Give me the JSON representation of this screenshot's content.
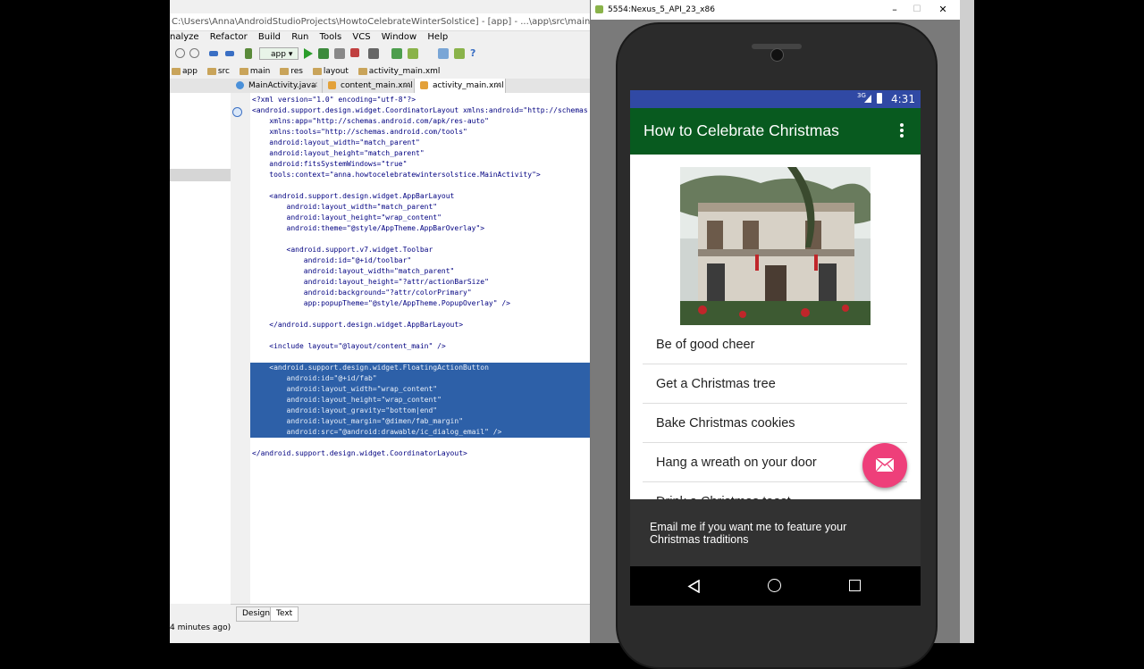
{
  "ide": {
    "title": "C:\\Users\\Anna\\AndroidStudioProjects\\HowtoCelebrateWinterSolstice] - [app] - ...\\app\\src\\main\\res\\layout\\activity_main.xml",
    "menu": [
      "nalyze",
      "Refactor",
      "Build",
      "Run",
      "Tools",
      "VCS",
      "Window",
      "Help"
    ],
    "toolbar_combo": "app",
    "breadcrumb": [
      "app",
      "src",
      "main",
      "res",
      "layout",
      "activity_main.xml"
    ],
    "tabs": [
      {
        "label": "MainActivity.java",
        "color": "#4a90d9"
      },
      {
        "label": "content_main.xml",
        "color": "#e3a13a"
      },
      {
        "label": "activity_main.xml",
        "color": "#e3a13a"
      }
    ],
    "bottom_tabs": [
      "Design",
      "Text"
    ],
    "status": "4 minutes ago)",
    "code_lines": [
      "<?xml version=\"1.0\" encoding=\"utf-8\"?>",
      "<android.support.design.widget.CoordinatorLayout xmlns:android=\"http://schemas",
      "    xmlns:app=\"http://schemas.android.com/apk/res-auto\"",
      "    xmlns:tools=\"http://schemas.android.com/tools\"",
      "    android:layout_width=\"match_parent\"",
      "    android:layout_height=\"match_parent\"",
      "    android:fitsSystemWindows=\"true\"",
      "    tools:context=\"anna.howtocelebratewintersolstice.MainActivity\">",
      "",
      "    <android.support.design.widget.AppBarLayout",
      "        android:layout_width=\"match_parent\"",
      "        android:layout_height=\"wrap_content\"",
      "        android:theme=\"@style/AppTheme.AppBarOverlay\">",
      "",
      "        <android.support.v7.widget.Toolbar",
      "            android:id=\"@+id/toolbar\"",
      "            android:layout_width=\"match_parent\"",
      "            android:layout_height=\"?attr/actionBarSize\"",
      "            android:background=\"?attr/colorPrimary\"",
      "            app:popupTheme=\"@style/AppTheme.PopupOverlay\" />",
      "",
      "    </android.support.design.widget.AppBarLayout>",
      "",
      "    <include layout=\"@layout/content_main\" />",
      "",
      "    <android.support.design.widget.FloatingActionButton",
      "        android:id=\"@+id/fab\"",
      "        android:layout_width=\"wrap_content\"",
      "        android:layout_height=\"wrap_content\"",
      "        android:layout_gravity=\"bottom|end\"",
      "        android:layout_margin=\"@dimen/fab_margin\"",
      "        android:src=\"@android:drawable/ic_dialog_email\" />",
      "",
      "</android.support.design.widget.CoordinatorLayout>"
    ]
  },
  "emulator": {
    "window_title": "5554:Nexus_5_API_23_x86",
    "network_label": "3G",
    "time": "4:31",
    "app_title": "How to Celebrate Christmas",
    "list_items": [
      "Be of good cheer",
      "Get a Christmas tree",
      "Bake Christmas cookies",
      "Hang a wreath on your door",
      "Drink a Christmas toast"
    ],
    "snackbar_text": "Email me if you want me to feature your Christmas traditions",
    "colors": {
      "status_bar": "#3049a4",
      "toolbar": "#085a1f",
      "fab": "#ee3f7a"
    }
  }
}
